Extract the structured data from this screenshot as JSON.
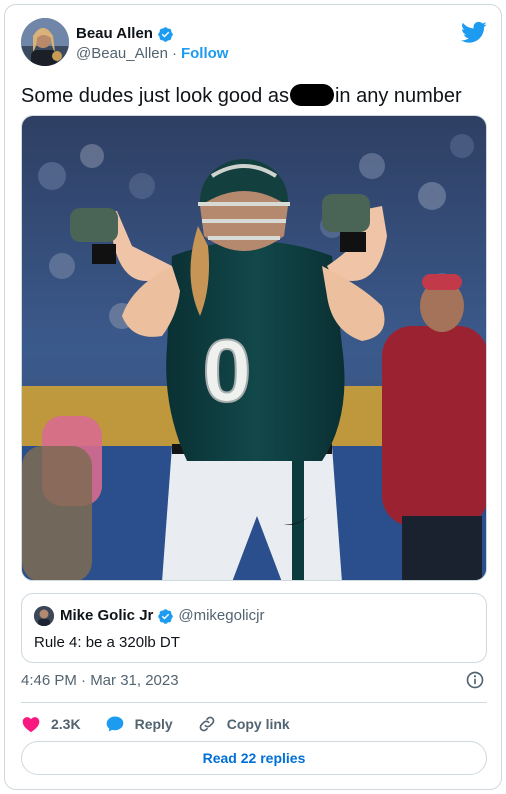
{
  "author": {
    "display_name": "Beau Allen",
    "handle": "@Beau_Allen",
    "separator": "·",
    "follow_label": "Follow"
  },
  "tweet": {
    "text_before": "Some dudes just look good as",
    "text_after": "in any number"
  },
  "photo": {
    "jersey_number": "0"
  },
  "quote": {
    "name": "Mike Golic Jr",
    "handle": "@mikegolicjr",
    "text": "Rule 4: be a 320lb DT"
  },
  "timestamp": "4:46 PM · Mar 31, 2023",
  "actions": {
    "like_count": "2.3K",
    "reply_label": "Reply",
    "copy_label": "Copy link"
  },
  "read_replies_label": "Read 22 replies",
  "colors": {
    "accent": "#1d9bf0",
    "like": "#f91880",
    "jersey": "#0b3b3c"
  }
}
